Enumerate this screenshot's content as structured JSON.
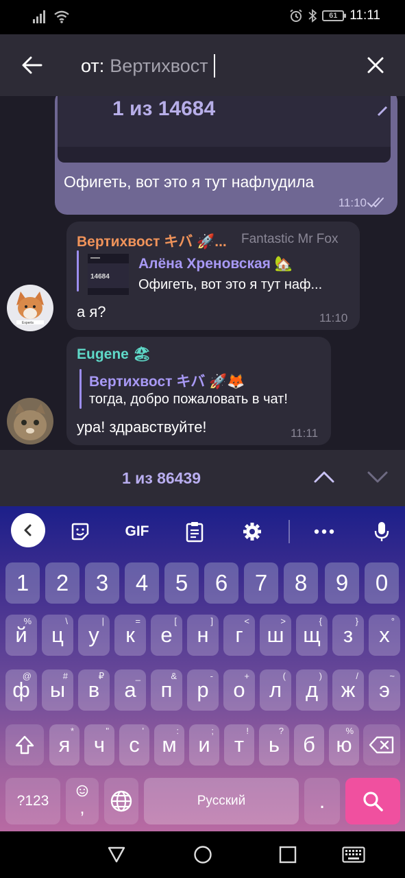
{
  "status_bar": {
    "time": "11:11",
    "battery": "61"
  },
  "search_header": {
    "prefix": "от:",
    "query": "Вертихвост"
  },
  "chat": {
    "outgoing": {
      "preview_count": "1 из 14684",
      "text": "Офигеть, вот это я тут нафлудила",
      "time": "11:10"
    },
    "messages": [
      {
        "sender": "Вертихвост キバ 🚀...",
        "sender_color": "#f0935a",
        "meta": "Fantastic Mr Fox",
        "thumb_count": "14684",
        "quote_name": "Алёна Хреновская 🏡",
        "quote_text": "Офигеть, вот это я тут наф...",
        "text": "а я?",
        "time": "11:10"
      },
      {
        "sender": "Eugene 🏖",
        "sender_color": "#5fd9c8",
        "quote_name": "Вертихвост キバ 🚀🦊",
        "quote_text": "тогда, добро пожаловать в чат!",
        "text": "ура! здравствуйте!",
        "time": "11:11"
      }
    ]
  },
  "search_nav": {
    "count": "1 из 86439"
  },
  "keyboard": {
    "toolbar": {
      "gif": "GIF"
    },
    "number_row": [
      "1",
      "2",
      "3",
      "4",
      "5",
      "6",
      "7",
      "8",
      "9",
      "0"
    ],
    "row1": [
      {
        "k": "й",
        "h": "%"
      },
      {
        "k": "ц",
        "h": "\\"
      },
      {
        "k": "у",
        "h": "|"
      },
      {
        "k": "к",
        "h": "="
      },
      {
        "k": "е",
        "h": "["
      },
      {
        "k": "н",
        "h": "]"
      },
      {
        "k": "г",
        "h": "<"
      },
      {
        "k": "ш",
        "h": ">"
      },
      {
        "k": "щ",
        "h": "{"
      },
      {
        "k": "з",
        "h": "}"
      },
      {
        "k": "х",
        "h": "°"
      }
    ],
    "row2": [
      {
        "k": "ф",
        "h": "@"
      },
      {
        "k": "ы",
        "h": "#"
      },
      {
        "k": "в",
        "h": "₽"
      },
      {
        "k": "а",
        "h": "_"
      },
      {
        "k": "п",
        "h": "&"
      },
      {
        "k": "р",
        "h": "-"
      },
      {
        "k": "о",
        "h": "+"
      },
      {
        "k": "л",
        "h": "("
      },
      {
        "k": "д",
        "h": ")"
      },
      {
        "k": "ж",
        "h": "/"
      },
      {
        "k": "э",
        "h": "~"
      }
    ],
    "row3": [
      {
        "k": "я",
        "h": "*"
      },
      {
        "k": "ч",
        "h": "\""
      },
      {
        "k": "с",
        "h": "'"
      },
      {
        "k": "м",
        "h": ":"
      },
      {
        "k": "и",
        "h": ";"
      },
      {
        "k": "т",
        "h": "!"
      },
      {
        "k": "ь",
        "h": "?"
      },
      {
        "k": "б",
        "h": ""
      },
      {
        "k": "ю",
        "h": "%"
      }
    ],
    "bottom": {
      "sym": "?123",
      "comma": ",",
      "space": "Русский",
      "period": "."
    }
  }
}
